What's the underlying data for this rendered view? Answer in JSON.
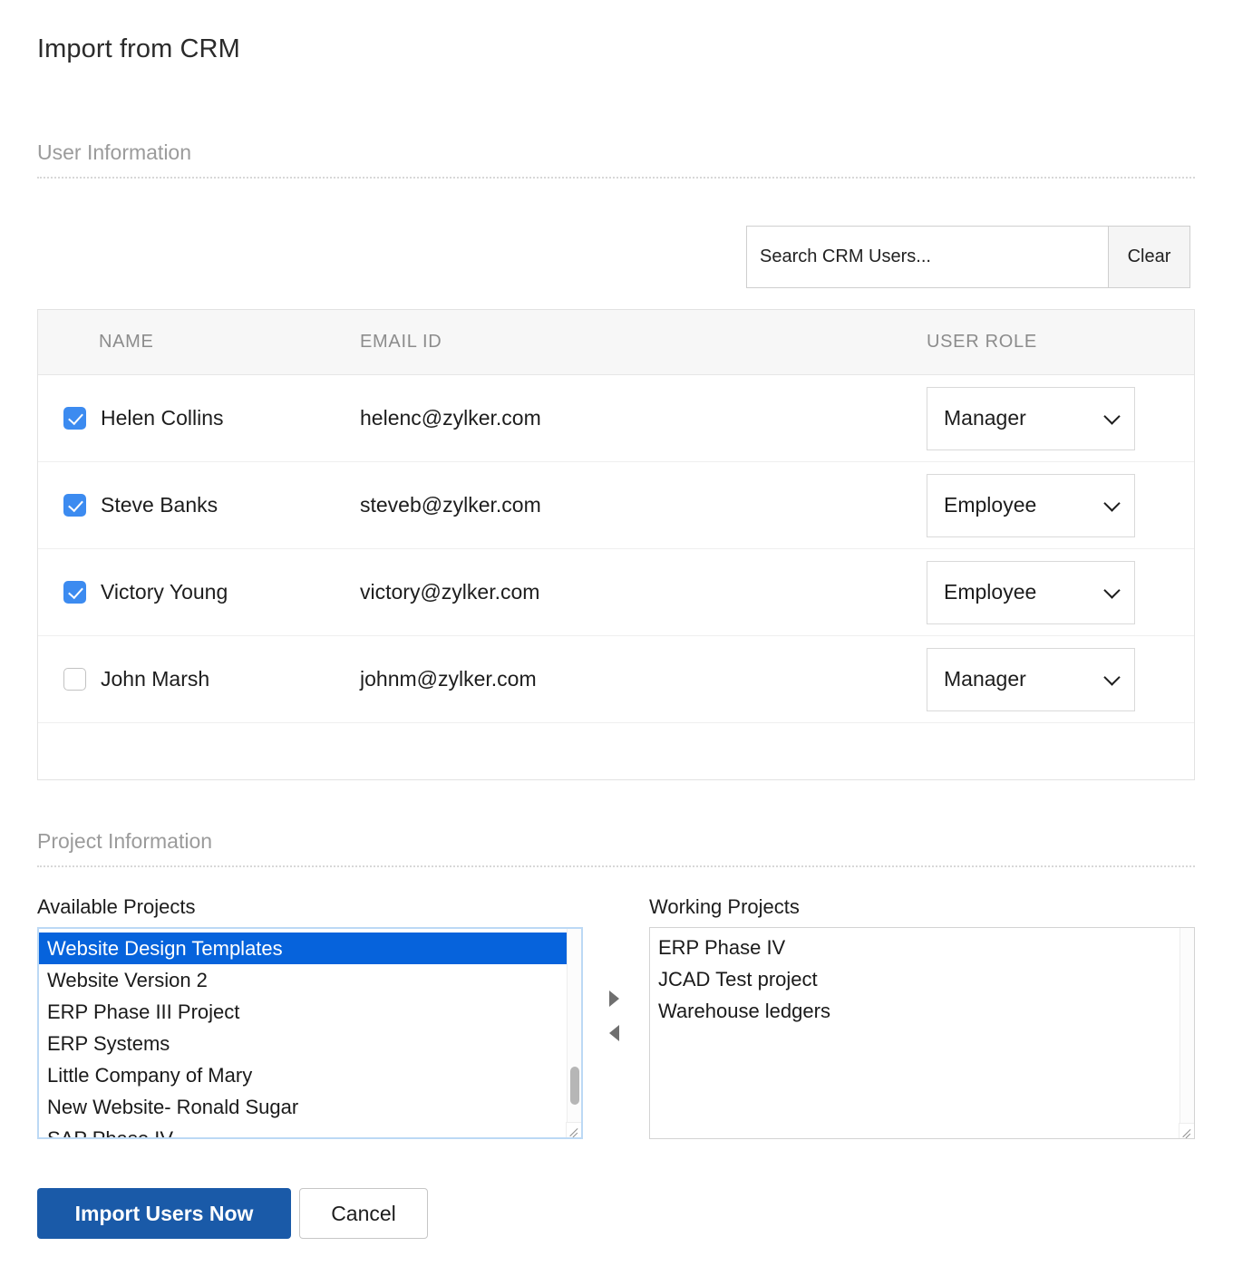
{
  "page": {
    "title": "Import from CRM"
  },
  "sections": {
    "user_information": "User Information",
    "project_information": "Project Information"
  },
  "search": {
    "placeholder": "Search CRM Users...",
    "value": "",
    "clear_label": "Clear"
  },
  "users_table": {
    "columns": [
      "NAME",
      "EMAIL ID",
      "USER ROLE"
    ],
    "rows": [
      {
        "checked": true,
        "name": "Helen Collins",
        "email": "helenc@zylker.com",
        "role": "Manager"
      },
      {
        "checked": true,
        "name": "Steve Banks",
        "email": "steveb@zylker.com",
        "role": "Employee"
      },
      {
        "checked": true,
        "name": "Victory Young",
        "email": "victory@zylker.com",
        "role": "Employee"
      },
      {
        "checked": false,
        "name": "John Marsh",
        "email": "johnm@zylker.com",
        "role": "Manager"
      }
    ],
    "role_options": [
      "Manager",
      "Employee"
    ]
  },
  "projects": {
    "available_label": "Available Projects",
    "working_label": "Working Projects",
    "available": [
      "Website Design Templates",
      "Website Version 2",
      "ERP Phase III Project",
      "ERP Systems",
      "Little Company of Mary",
      "New Website- Ronald Sugar",
      "SAP Phase IV"
    ],
    "available_selected_index": 0,
    "working": [
      "ERP Phase IV",
      "JCAD Test project",
      "Warehouse ledgers"
    ],
    "move_right_icon": "triangle-right-icon",
    "move_left_icon": "triangle-left-icon"
  },
  "footer": {
    "import_label": "Import Users Now",
    "cancel_label": "Cancel"
  },
  "colors": {
    "primary_button": "#1a5aa8",
    "checkbox_checked": "#3c8bf0",
    "list_selection": "#0663dc",
    "heading_gray": "#9b9b9b"
  }
}
